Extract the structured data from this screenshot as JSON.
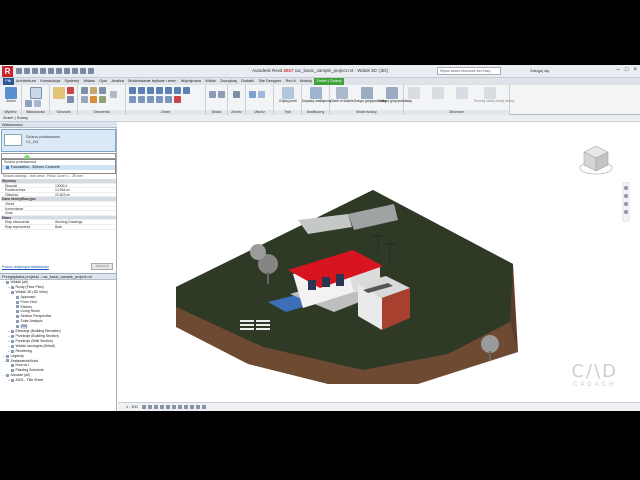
{
  "titlebar": {
    "app_name": "Autodesk Revit",
    "app_year": "2017",
    "document": "rac_basic_sample_project.rvt - Widok 3D: {3D}",
    "search_placeholder": "Wpisz słowo kluczowe lub frazę",
    "user": "Zaloguj się"
  },
  "tabs": [
    "Plik",
    "Architektura",
    "Konstrukcja",
    "Systemy",
    "Wstaw",
    "Opis",
    "Analiza",
    "Modelowanie bryłowe i teren",
    "Współpraca",
    "Widok",
    "Zarządzaj",
    "Dodatki",
    "Site Designer",
    "Rev-it",
    "Moduły",
    "Zmień | Ściany"
  ],
  "ribbon": {
    "panels": [
      "Wybierz",
      "Właściwości",
      "Schowek",
      "Geometria",
      "Zmień",
      "Widok",
      "Zmierz",
      "Utwórz",
      "Tryb",
      "Analityczny",
      "Model ściany",
      "Zbiorowe"
    ],
    "buttons": {
      "modify": "Zmień",
      "select": "Wybierz",
      "properties": "Właściwości",
      "edit_profile": "Edytuj profil",
      "reset_profile": "Resetuj profil",
      "analytical": "Dopasuj analityczny",
      "opening": "Otwór w ścianie",
      "attach": "Dołącz górę/podstawę",
      "detach": "Odłącz górę/podstawę",
      "assembly": "Utwórz zespół",
      "parts": "Utwórz części",
      "split": "Podziel ciąg",
      "add": "Dodaj",
      "reset_wall_zone": "Resetuj strefę dolnej ściany"
    }
  },
  "context_bar": "Zmień | Ściany",
  "properties": {
    "title": "Właściwości",
    "type_family": "Ściana podstawowa",
    "type_name": "CL_W1",
    "dropdown_value": "",
    "dropdown_header": "Ściana podstawowa",
    "dropdown_item": "Foundation - 300mm Concrete",
    "behind_row": "Ściana dolnego - bok zewn.    Połóż Cover 1 - 25 mm",
    "rows": [
      {
        "k": "Wymiary",
        "v": "",
        "group": true
      },
      {
        "k": "Długość",
        "v": "13000,0",
        "group": false
      },
      {
        "k": "Powierzchnia",
        "v": "14,964 m²",
        "group": false
      },
      {
        "k": "Objętość",
        "v": "20,823 m³",
        "group": false
      },
      {
        "k": "Dane identyfikacyjne",
        "v": "",
        "group": true
      },
      {
        "k": "Obraz",
        "v": "",
        "group": false
      },
      {
        "k": "Komentarze",
        "v": "",
        "group": false
      },
      {
        "k": "Znak",
        "v": "",
        "group": false
      },
      {
        "k": "Etapy",
        "v": "",
        "group": true
      },
      {
        "k": "Etap utworzenia",
        "v": "Working Drawings",
        "group": false
      },
      {
        "k": "Etap wyburzenia",
        "v": "Brak",
        "group": false
      }
    ],
    "help_link": "Pomoc dotycząca właściwości",
    "apply_button": "Zastosuj"
  },
  "project_browser": {
    "title": "Przeglądarka projektu - rac_basic_sample_project.rvt",
    "nodes": [
      {
        "label": "Widoki (all)",
        "indent": 0,
        "tw": "−",
        "hl": false
      },
      {
        "label": "Rzuty (Floor Plan)",
        "indent": 1,
        "tw": "+",
        "hl": false
      },
      {
        "label": "Widoki 3D (3D View)",
        "indent": 1,
        "tw": "−",
        "hl": false
      },
      {
        "label": "Approach",
        "indent": 2,
        "tw": "",
        "hl": false
      },
      {
        "label": "From Yard",
        "indent": 2,
        "tw": "",
        "hl": false
      },
      {
        "label": "Kitchen",
        "indent": 2,
        "tw": "",
        "hl": false
      },
      {
        "label": "Living Room",
        "indent": 2,
        "tw": "",
        "hl": false
      },
      {
        "label": "Section Perspective",
        "indent": 2,
        "tw": "",
        "hl": false
      },
      {
        "label": "Solar Analysis",
        "indent": 2,
        "tw": "",
        "hl": false
      },
      {
        "label": "{3D}",
        "indent": 2,
        "tw": "",
        "hl": true
      },
      {
        "label": "Elewacje (Building Elevation)",
        "indent": 1,
        "tw": "+",
        "hl": false
      },
      {
        "label": "Przekroje (Building Section)",
        "indent": 1,
        "tw": "+",
        "hl": false
      },
      {
        "label": "Przekroje (Wall Section)",
        "indent": 1,
        "tw": "+",
        "hl": false
      },
      {
        "label": "Widoki szczegółu (Detail)",
        "indent": 1,
        "tw": "+",
        "hl": false
      },
      {
        "label": "Rendering",
        "indent": 1,
        "tw": "+",
        "hl": false
      },
      {
        "label": "Legendy",
        "indent": 0,
        "tw": "+",
        "hl": false
      },
      {
        "label": "Zestawienia/Ilości",
        "indent": 0,
        "tw": "−",
        "hl": false
      },
      {
        "label": "How do I",
        "indent": 1,
        "tw": "",
        "hl": false
      },
      {
        "label": "Planting Schedule",
        "indent": 1,
        "tw": "",
        "hl": false
      },
      {
        "label": "Arkusze (all)",
        "indent": 0,
        "tw": "−",
        "hl": false
      },
      {
        "label": "A001 - Title Sheet",
        "indent": 1,
        "tw": "+",
        "hl": false
      }
    ]
  },
  "view_control": {
    "scale": "1 : 100"
  },
  "viewcube_face": "PRZÓD",
  "watermark": {
    "logo": "C/\\D",
    "text": "CADACH"
  },
  "colors": {
    "roof": "#d8141f",
    "terrain_top": "#2e3a26",
    "terrain_side": "#6b4530",
    "accent_tab": "#3fa33a",
    "file_tab": "#2b5797"
  }
}
